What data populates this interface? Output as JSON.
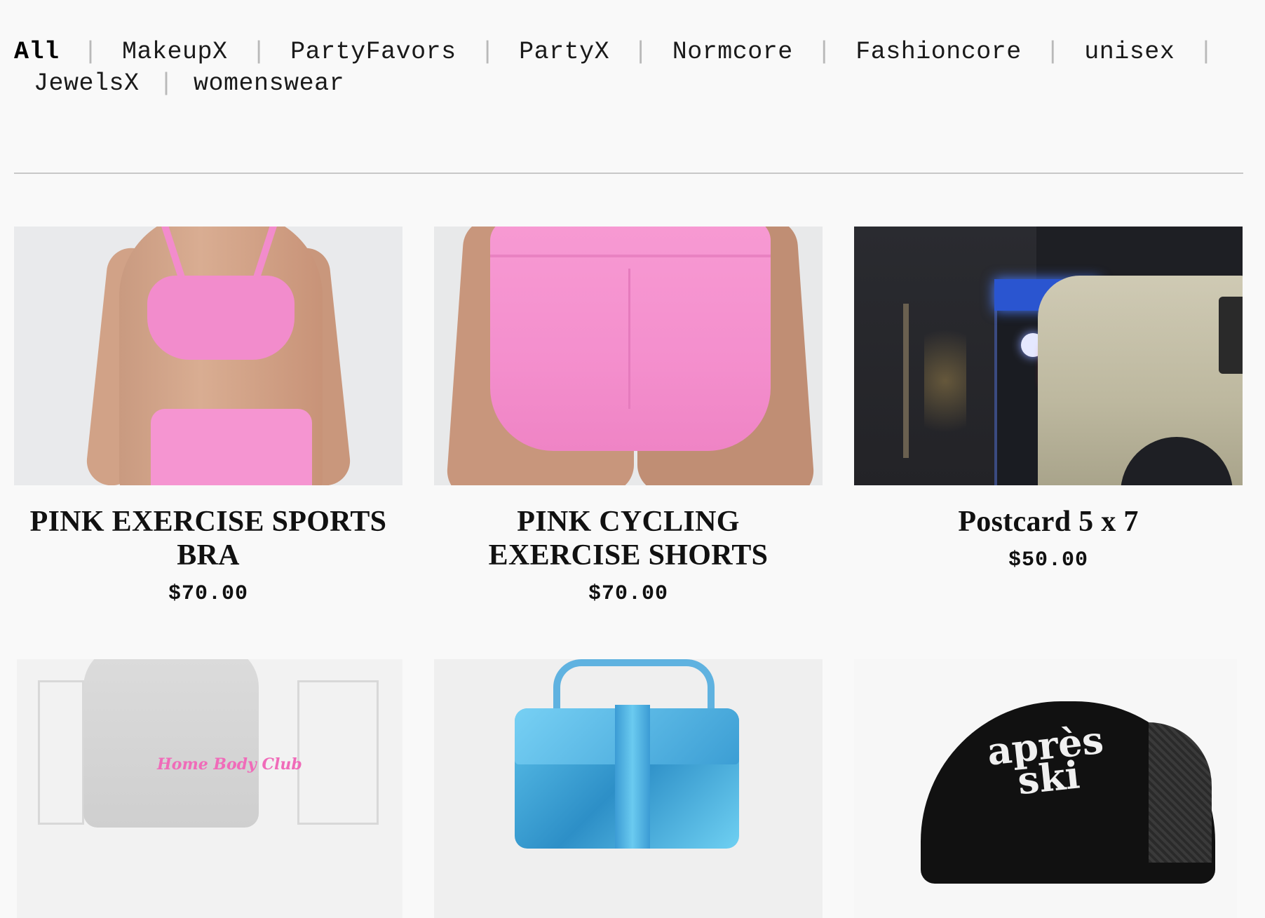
{
  "filters": {
    "items": [
      {
        "label": "All",
        "active": true
      },
      {
        "label": "MakeupX",
        "active": false
      },
      {
        "label": "PartyFavors",
        "active": false
      },
      {
        "label": "PartyX",
        "active": false
      },
      {
        "label": "Normcore",
        "active": false
      },
      {
        "label": "Fashioncore",
        "active": false
      },
      {
        "label": "unisex",
        "active": false
      },
      {
        "label": "JewelsX",
        "active": false
      },
      {
        "label": "womenswear",
        "active": false
      }
    ],
    "separator": "|"
  },
  "products": [
    {
      "title": "PINK EXERCISE SPORTS BRA",
      "price": "$70.00",
      "image": "pink-sports-bra-photo"
    },
    {
      "title": "PINK CYCLING EXERCISE SHORTS",
      "price": "$70.00",
      "image": "pink-cycling-shorts-photo"
    },
    {
      "title": "Postcard 5 x 7",
      "price": "$50.00",
      "image": "night-street-van-photo"
    },
    {
      "title": "",
      "price": "",
      "image": "grey-sweatsuit-photo",
      "image_text": "Home Body Club"
    },
    {
      "title": "",
      "price": "",
      "image": "blue-metallic-bag-photo"
    },
    {
      "title": "",
      "price": "",
      "image": "black-trucker-cap-photo",
      "image_text": "après ski"
    }
  ],
  "colors": {
    "background": "#f9f9f9",
    "text": "#111111",
    "separator": "#b9b9b9",
    "divider": "#c8c8c8"
  }
}
